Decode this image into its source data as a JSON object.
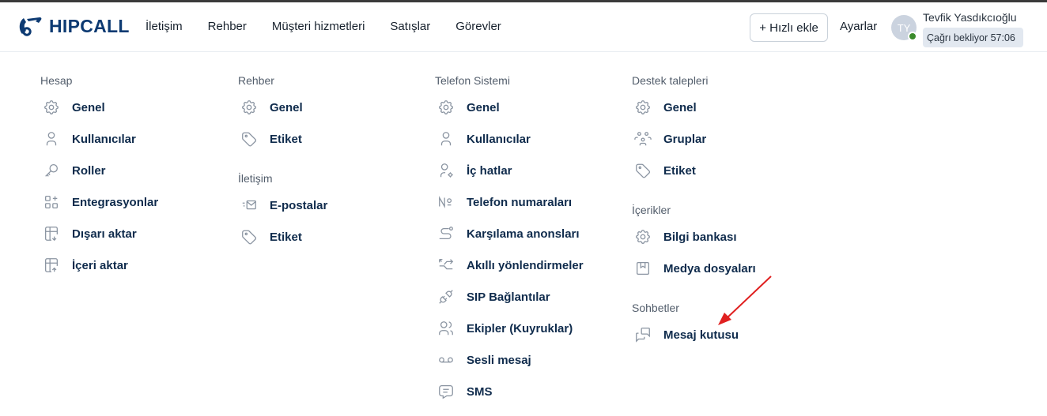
{
  "brand": {
    "name": "HIPCALL",
    "color": "#0d3a72"
  },
  "topnav": [
    {
      "label": "İletişim"
    },
    {
      "label": "Rehber"
    },
    {
      "label": "Müşteri hizmetleri"
    },
    {
      "label": "Satışlar"
    },
    {
      "label": "Görevler"
    }
  ],
  "header": {
    "quick_add": "+ Hızlı ekle",
    "settings": "Ayarlar",
    "avatar_initials": "TY",
    "user_name": "Tevfik Yasdıkcıoğlu",
    "call_status": "Çağrı bekliyor 57:06",
    "status_color": "#3a8a2b"
  },
  "columns": [
    {
      "sections": [
        {
          "title": "Hesap",
          "items": [
            {
              "label": "Genel",
              "icon": "gear-icon"
            },
            {
              "label": "Kullanıcılar",
              "icon": "user-icon"
            },
            {
              "label": "Roller",
              "icon": "key-icon"
            },
            {
              "label": "Entegrasyonlar",
              "icon": "apps-add-icon"
            },
            {
              "label": "Dışarı aktar",
              "icon": "table-export-icon"
            },
            {
              "label": "İçeri aktar",
              "icon": "table-import-icon"
            }
          ]
        }
      ]
    },
    {
      "sections": [
        {
          "title": "Rehber",
          "items": [
            {
              "label": "Genel",
              "icon": "gear-icon"
            },
            {
              "label": "Etiket",
              "icon": "tag-icon"
            }
          ]
        },
        {
          "title": "İletişim",
          "items": [
            {
              "label": "E-postalar",
              "icon": "mail-fast-icon"
            },
            {
              "label": "Etiket",
              "icon": "tag-icon"
            }
          ]
        }
      ]
    },
    {
      "sections": [
        {
          "title": "Telefon Sistemi",
          "items": [
            {
              "label": "Genel",
              "icon": "gear-icon"
            },
            {
              "label": "Kullanıcılar",
              "icon": "user-icon"
            },
            {
              "label": "İç hatlar",
              "icon": "user-cog-icon"
            },
            {
              "label": "Telefon numaraları",
              "icon": "numero-icon"
            },
            {
              "label": "Karşılama anonsları",
              "icon": "route-icon"
            },
            {
              "label": "Akıllı yönlendirmeler",
              "icon": "arrows-split-icon"
            },
            {
              "label": "SIP Bağlantılar",
              "icon": "plug-icon"
            },
            {
              "label": "Ekipler (Kuyruklar)",
              "icon": "users-icon"
            },
            {
              "label": "Sesli mesaj",
              "icon": "voicemail-icon"
            },
            {
              "label": "SMS",
              "icon": "message-icon"
            }
          ]
        }
      ]
    },
    {
      "sections": [
        {
          "title": "Destek talepleri",
          "items": [
            {
              "label": "Genel",
              "icon": "gear-icon"
            },
            {
              "label": "Gruplar",
              "icon": "users-group-icon"
            },
            {
              "label": "Etiket",
              "icon": "tag-icon"
            }
          ]
        },
        {
          "title": "İçerikler",
          "items": [
            {
              "label": "Bilgi bankası",
              "icon": "gear-icon"
            },
            {
              "label": "Medya dosyaları",
              "icon": "bookmark-box-icon"
            }
          ]
        },
        {
          "title": "Sohbetler",
          "items": [
            {
              "label": "Mesaj kutusu",
              "icon": "messages-icon"
            }
          ]
        }
      ]
    }
  ],
  "annotation": {
    "arrow_color": "#e02020"
  }
}
